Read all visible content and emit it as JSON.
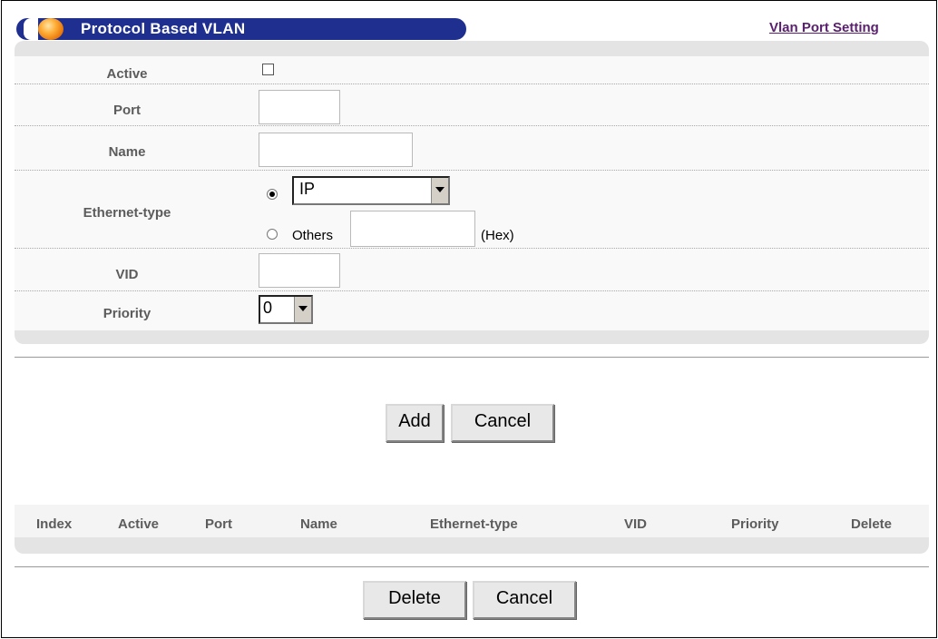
{
  "header": {
    "title": "Protocol Based VLAN",
    "link": "Vlan Port Setting"
  },
  "form": {
    "active_label": "Active",
    "active_checked": false,
    "port_label": "Port",
    "port_value": "",
    "name_label": "Name",
    "name_value": "",
    "ethernet_type_label": "Ethernet-type",
    "ethernet_type_selected": "IP",
    "others_label": "Others",
    "others_value": "",
    "hex_label": "(Hex)",
    "vid_label": "VID",
    "vid_value": "",
    "priority_label": "Priority",
    "priority_selected": "0"
  },
  "buttons": {
    "add": "Add",
    "cancel": "Cancel",
    "delete": "Delete",
    "cancel2": "Cancel"
  },
  "table": {
    "columns": [
      "Index",
      "Active",
      "Port",
      "Name",
      "Ethernet-type",
      "VID",
      "Priority",
      "Delete"
    ]
  },
  "colors": {
    "header_bar": "#1e2f8f",
    "link": "#5a1f6e"
  }
}
